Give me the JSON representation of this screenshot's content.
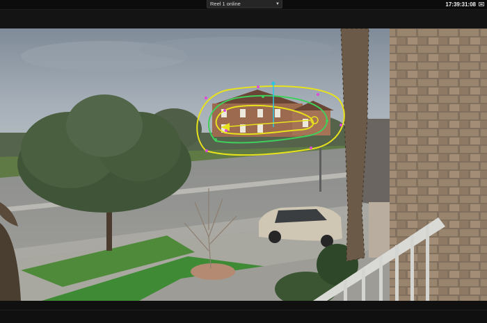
{
  "toolbar": {
    "clip_name": "Reel 1 online",
    "timecode": "17:39:31:08",
    "dropdown_icon": "chevron-down-icon",
    "viewer_icon": "viewer-mode-icon"
  },
  "viewer": {
    "overlay_colors": {
      "outer_shape": "#e8e21c",
      "inner_shape": "#3fcf5a",
      "points": "#e14ad6",
      "center_handle": "#28c8e4"
    }
  }
}
